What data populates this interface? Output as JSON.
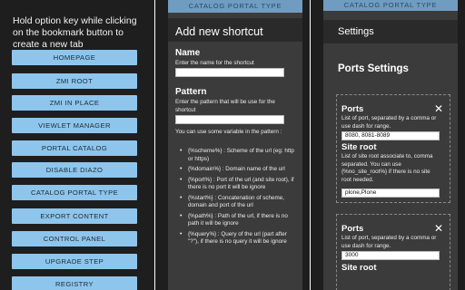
{
  "panel1": {
    "instruction": "Hold option key while clicking on the bookmark button to create a new tab",
    "buttons": [
      "HOMEPAGE",
      "ZMI ROOT",
      "ZMI IN PLACE",
      "VIEWLET MANAGER",
      "PORTAL CATALOG",
      "DISABLE DIAZO",
      "CATALOG PORTAL TYPE",
      "EXPORT CONTENT",
      "CONTROL PANEL",
      "UPGRADE STEP",
      "REGISTRY"
    ]
  },
  "panel2": {
    "top_bar": "CATALOG PORTAL TYPE",
    "title": "Add new shortcut",
    "name_label": "Name",
    "name_help": "Enter the name for the shortcut",
    "pattern_label": "Pattern",
    "pattern_help": "Enter the pattern that will be use for the shortcut",
    "variables_intro": "You can use some variable in the pattern :",
    "variables": [
      "{%scheme%} : Scheme of the url (eg: http or https)",
      "{%domain%} : Domain name of the url",
      "{%port%} : Port of the url (and site root), if there is no port it will be ignore",
      "{%start%} : Concatenation of scheme, domain and port of the url",
      "{%path%} : Path of the url, if there is no path it will be ignore",
      "{%query%} : Query of the url (part after \"?\"), if there is no query it will be ignore"
    ]
  },
  "panel3": {
    "top_bar": "CATALOG PORTAL TYPE",
    "settings_title": "Settings",
    "ports_settings_title": "Ports Settings",
    "ports_label": "Ports",
    "ports_help": "List of port, separated by a comma or use dash for range.",
    "site_root_label": "Site root",
    "site_root_help": "List of site root associate to, comma separated. You can use {%no_site_root%} if there is no site root needed.",
    "entries": [
      {
        "ports_value": "8080, 8081-8089",
        "site_root_value": "plone,Plone"
      },
      {
        "ports_value": "3000"
      }
    ],
    "close_glyph": "✕"
  }
}
